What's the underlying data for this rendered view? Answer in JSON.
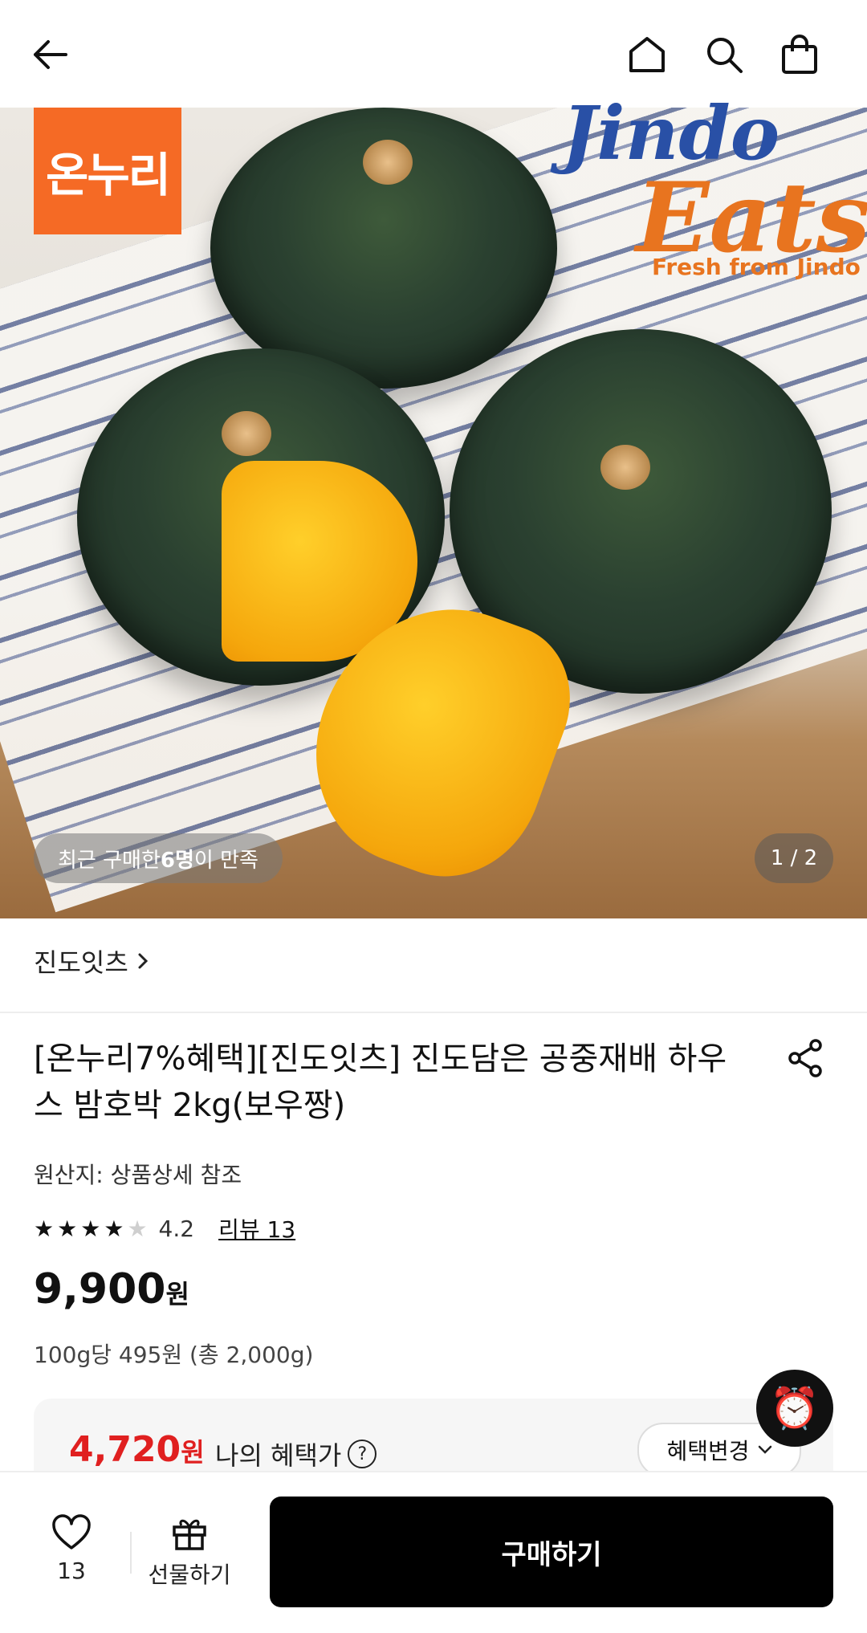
{
  "product": {
    "store_name": "진도잇츠",
    "title": "[온누리7%혜택][진도잇츠] 진도담은 공중재배 하우스 밤호박 2kg(보우짱)",
    "origin": "원산지: 상품상세 참조",
    "rating_score": "4.2",
    "rating_value": 4.2,
    "review_link": "리뷰 13",
    "price": "9,900",
    "price_currency": "원",
    "unit_price": "100g당 495원 (총 2,000g)"
  },
  "hero": {
    "logo_text": "온누리",
    "brand_top": "Jindo",
    "brand_eats": "Eats",
    "brand_sub": "Fresh from Jindo",
    "satisfaction_prefix": "최근 구매한 ",
    "satisfaction_count": "6명",
    "satisfaction_suffix": "이 만족",
    "page_indicator": "1 / 2"
  },
  "benefit": {
    "price": "4,720",
    "currency": "원",
    "label": "나의 혜택가",
    "help": "?",
    "change_button": "혜택변경"
  },
  "bottom": {
    "wish_count": "13",
    "gift_label": "선물하기",
    "buy_label": "구매하기"
  },
  "icons": {
    "back": "back-arrow-icon",
    "home": "home-icon",
    "search": "search-icon",
    "bag": "shopping-bag-icon",
    "share": "share-icon",
    "heart": "heart-icon",
    "gift": "gift-icon",
    "alarm": "alarm-clock-icon"
  },
  "colors": {
    "accent_red": "#e02020",
    "logo_orange": "#f56a25",
    "buy_button": "#000000"
  }
}
